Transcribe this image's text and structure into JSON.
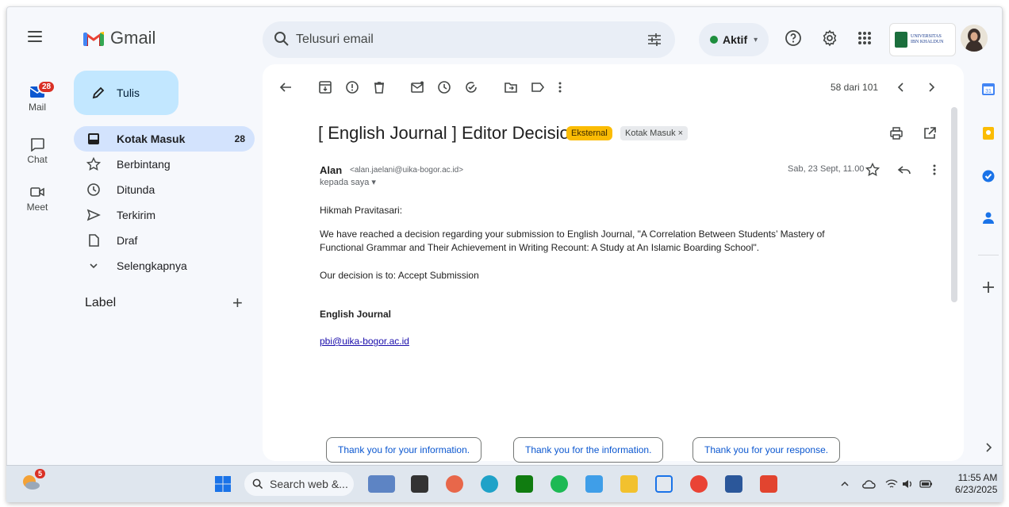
{
  "app": {
    "name": "Gmail"
  },
  "search": {
    "placeholder": "Telusuri email"
  },
  "status": {
    "label": "Aktif"
  },
  "account": {
    "org_line1": "UNIVERSITAS",
    "org_line2": "IBN KHALDUN"
  },
  "rail": {
    "mail": {
      "label": "Mail",
      "badge": "28"
    },
    "chat": {
      "label": "Chat"
    },
    "meet": {
      "label": "Meet"
    }
  },
  "compose": {
    "label": "Tulis"
  },
  "nav": {
    "items": [
      {
        "label": "Kotak Masuk",
        "count": "28",
        "icon": "inbox-icon"
      },
      {
        "label": "Berbintang",
        "icon": "star-icon"
      },
      {
        "label": "Ditunda",
        "icon": "clock-icon"
      },
      {
        "label": "Terkirim",
        "icon": "send-icon"
      },
      {
        "label": "Draf",
        "icon": "file-icon"
      },
      {
        "label": "Selengkapnya",
        "icon": "chevron-down-icon"
      }
    ],
    "labels_heading": "Label"
  },
  "toolbar": {
    "pager": "58 dari 101"
  },
  "email": {
    "subject": "[ English Journal ] Editor Decision",
    "chip_external": "Eksternal",
    "chip_inbox": "Kotak Masuk ×",
    "sender_name": "Alan",
    "sender_email": "<alan.jaelani@uika-bogor.ac.id>",
    "to": "kepada saya ▾",
    "date": "Sab, 23 Sept, 11.00",
    "greeting": "Hikmah Pravitasari:",
    "body_line1": "We have reached a decision regarding your submission to English Journal, \"A Correlation Between Students’ Mastery of",
    "body_line2": "Functional Grammar and Their Achievement in Writing Recount: A Study at An Islamic Boarding School\".",
    "decision": "Our decision is to: Accept Submission",
    "signature": "English Journal",
    "signature_link": "pbi@uika-bogor.ac.id"
  },
  "smart_replies": [
    "Thank you for your information.",
    "Thank you for the information.",
    "Thank you for your response."
  ],
  "taskbar": {
    "weather_badge": "5",
    "search_label": "Search web &...",
    "time": "11:55 AM",
    "date": "6/23/2025"
  },
  "colors": {
    "compose_bg": "#c2e7ff",
    "active_nav": "#d3e3fd",
    "external_chip": "#fbbc04",
    "link": "#1a0dab",
    "status_dot": "#1e8e3e"
  }
}
